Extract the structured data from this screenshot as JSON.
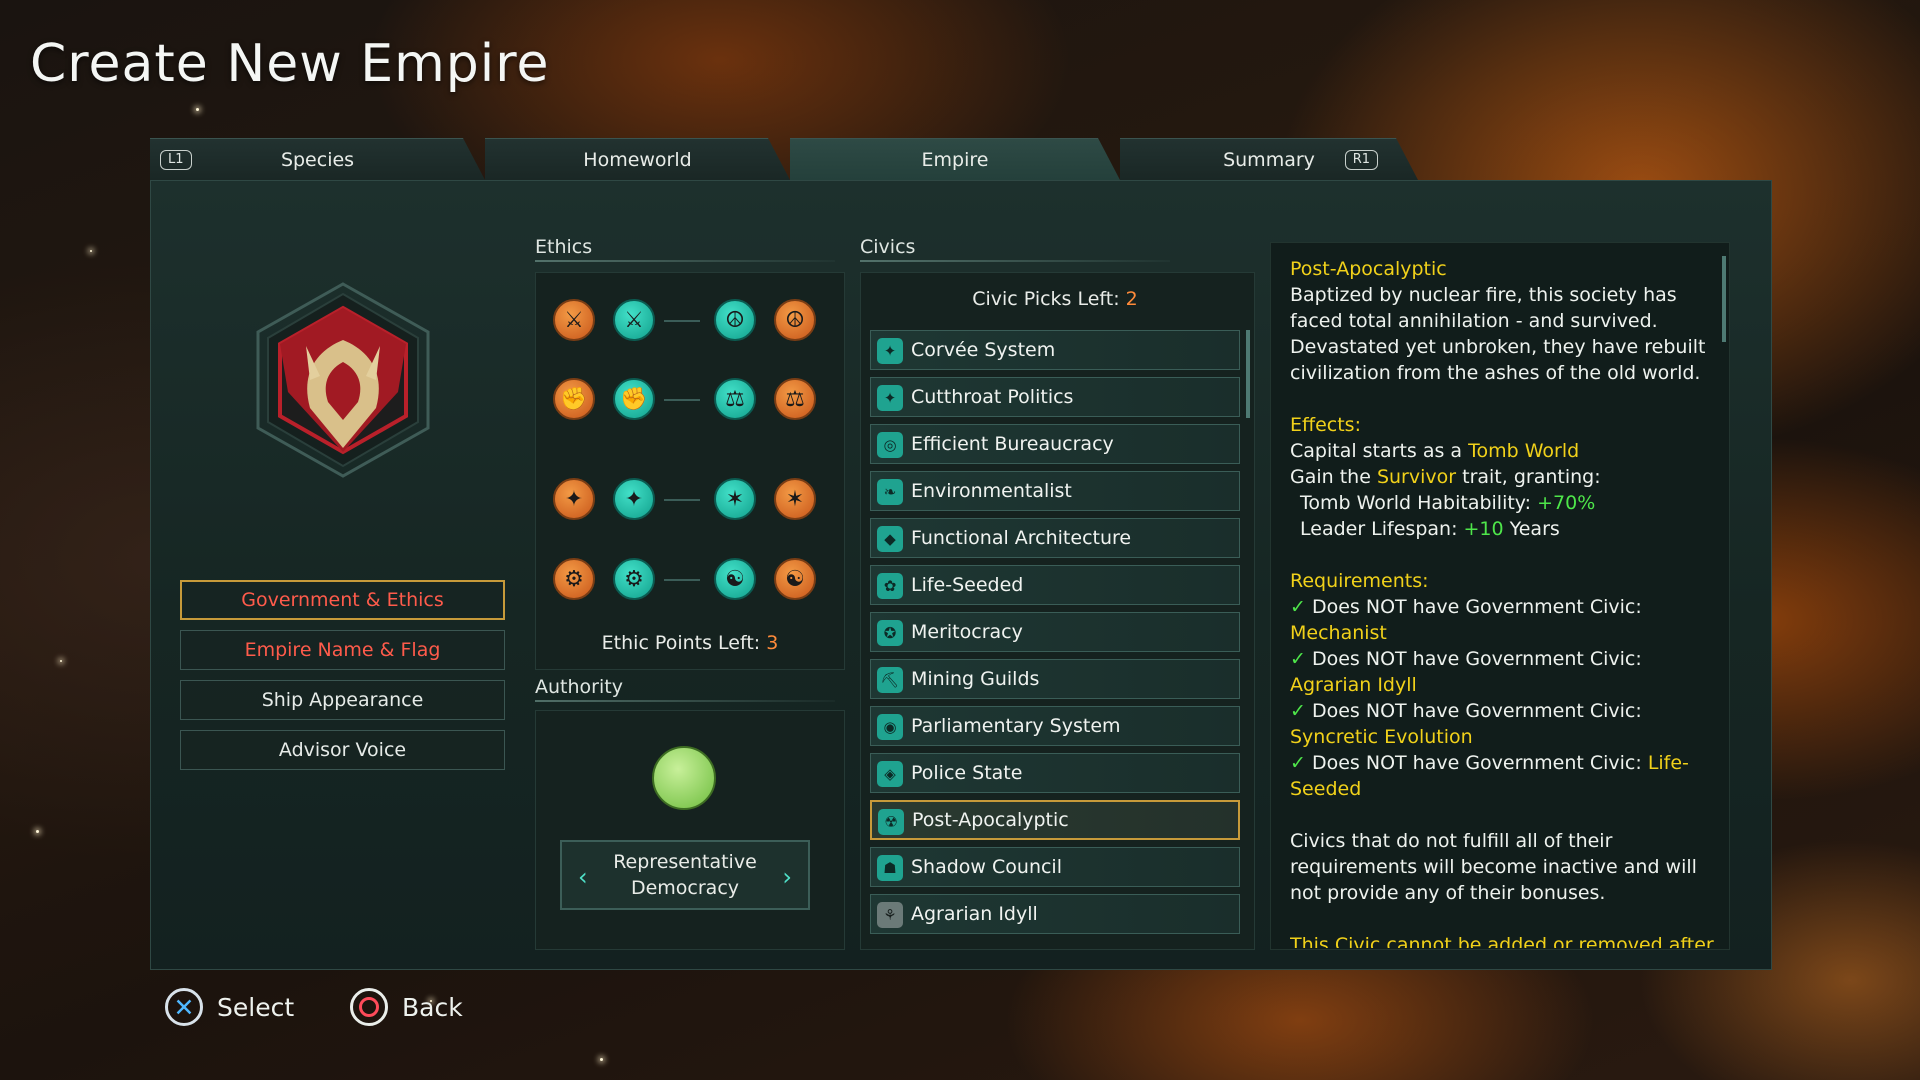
{
  "page_title": "Create New Empire",
  "tabs": {
    "l1_hint": "L1",
    "r1_hint": "R1",
    "species": "Species",
    "homeworld": "Homeworld",
    "empire": "Empire",
    "summary": "Summary"
  },
  "left_menu": {
    "government_ethics": "Government & Ethics",
    "empire_name_flag": "Empire Name & Flag",
    "ship_appearance": "Ship Appearance",
    "advisor_voice": "Advisor Voice"
  },
  "ethics": {
    "header": "Ethics",
    "points_label": "Ethic Points Left: ",
    "points_value": "3"
  },
  "authority": {
    "header": "Authority",
    "selected_line1": "Representative",
    "selected_line2": "Democracy"
  },
  "civics": {
    "header": "Civics",
    "picks_label": "Civic Picks Left: ",
    "picks_value": "2",
    "items": [
      "Corvée System",
      "Cutthroat Politics",
      "Efficient Bureaucracy",
      "Environmentalist",
      "Functional Architecture",
      "Life-Seeded",
      "Meritocracy",
      "Mining Guilds",
      "Parliamentary System",
      "Police State",
      "Post-Apocalyptic",
      "Shadow Council",
      "Agrarian Idyll"
    ]
  },
  "description": {
    "title": "Post-Apocalyptic",
    "body": "Baptized by nuclear fire, this society has faced total annihilation - and survived. Devastated yet unbroken, they have rebuilt civilization from the ashes of the old world.",
    "effects_header": "Effects:",
    "effect1_prefix": "Capital starts as a ",
    "effect1_value": "Tomb World",
    "effect2_prefix": "Gain the ",
    "effect2_value": "Survivor",
    "effect2_suffix": " trait, granting:",
    "effect3_label": "Tomb World Habitability: ",
    "effect3_value": "+70%",
    "effect4_label": "Leader Lifespan: ",
    "effect4_value": "+10",
    "effect4_suffix": " Years",
    "requirements_header": "Requirements:",
    "req_prefix": "Does NOT have Government Civic: ",
    "req1": "Mechanist",
    "req2": "Agrarian Idyll",
    "req3": "Syncretic Evolution",
    "req4": "Life-Seeded",
    "note": "Civics that do not fulfill all of their requirements will become inactive and will not provide any of their bonuses.",
    "cut_text": "This Civic cannot be added or removed after"
  },
  "prompts": {
    "select": "Select",
    "back": "Back"
  },
  "colors": {
    "accent_teal": "#1fa390",
    "ethic_orange": "#e07a2e",
    "highlight_yellow": "#f1d11a",
    "positive_green": "#4ee64a",
    "warning_red": "#ff5b4b",
    "selected_border": "#c79a3a"
  }
}
